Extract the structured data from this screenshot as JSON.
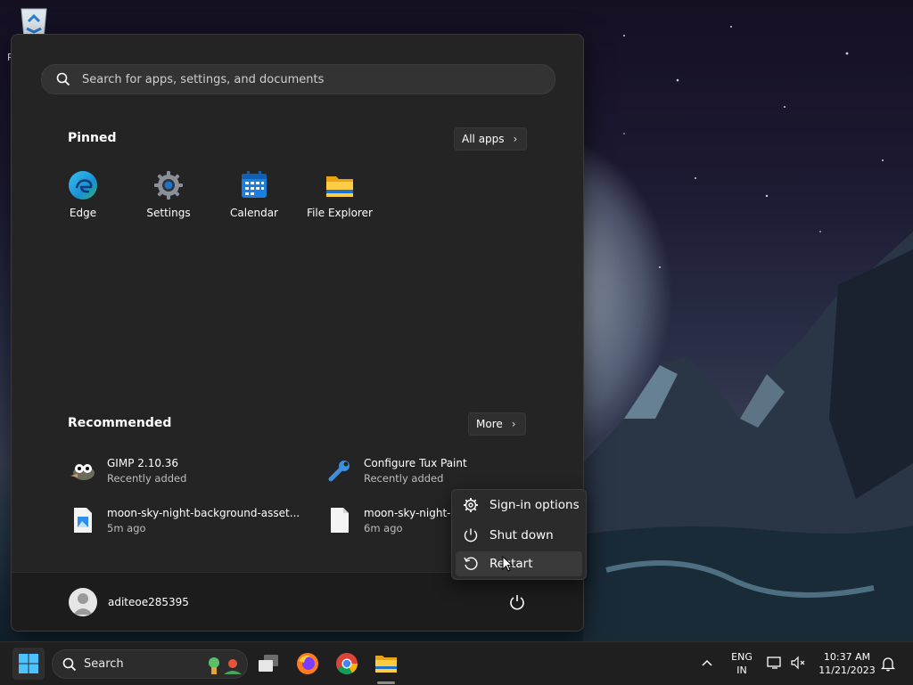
{
  "desktop": {
    "recycle_bin_label": "R"
  },
  "start_menu": {
    "search_placeholder": "Search for apps, settings, and documents",
    "pinned": {
      "title": "Pinned",
      "all_apps_label": "All apps",
      "apps": [
        {
          "label": "Edge",
          "icon": "edge-icon"
        },
        {
          "label": "Settings",
          "icon": "settings-icon"
        },
        {
          "label": "Calendar",
          "icon": "calendar-icon"
        },
        {
          "label": "File Explorer",
          "icon": "file-explorer-icon"
        }
      ]
    },
    "recommended": {
      "title": "Recommended",
      "more_label": "More",
      "items": [
        {
          "title": "GIMP 2.10.36",
          "subtitle": "Recently added",
          "icon": "gimp-icon"
        },
        {
          "title": "Configure Tux Paint",
          "subtitle": "Recently added",
          "icon": "wrench-icon"
        },
        {
          "title": "moon-sky-night-background-asset...",
          "subtitle": "5m ago",
          "icon": "image-file-icon"
        },
        {
          "title": "moon-sky-night-b",
          "subtitle": "6m ago",
          "icon": "file-icon"
        }
      ]
    },
    "footer": {
      "username": "aditeoe285395"
    }
  },
  "power_menu": {
    "items": [
      {
        "label": "Sign-in options",
        "icon": "gear-icon"
      },
      {
        "label": "Shut down",
        "icon": "power-icon"
      },
      {
        "label": "Restart",
        "icon": "restart-icon"
      }
    ]
  },
  "taskbar": {
    "search_label": "Search",
    "language_line1": "ENG",
    "language_line2": "IN",
    "time": "10:37 AM",
    "date": "11/21/2023"
  },
  "colors": {
    "accent": "#0078d4",
    "menu_bg": "#242424",
    "taskbar_bg": "#1f1f1f"
  }
}
